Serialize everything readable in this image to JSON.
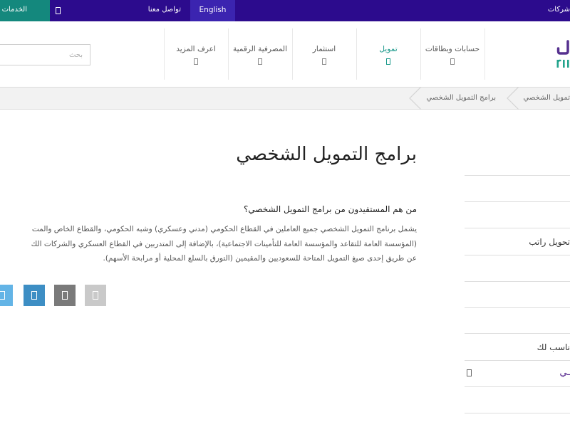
{
  "topbar": {
    "services_label": "الخدمات",
    "services_icon": "grid-icon",
    "contact_label": "تواصل معنا",
    "language_label": "English",
    "companies_label": "شركات",
    "colors": {
      "bar": "#2c0b8d",
      "services": "#14887d",
      "language": "#3b24b0"
    }
  },
  "logo": {
    "colors": {
      "primary": "#56318f",
      "secondary": "#22a38c"
    }
  },
  "nav": {
    "search_placeholder": "بحث",
    "item_icon": "chevron-down-icon",
    "items": [
      {
        "label": "حسابات وبطاقات",
        "active": false
      },
      {
        "label": "تمويل",
        "active": true
      },
      {
        "label": "استثمار",
        "active": false
      },
      {
        "label": "المصرفية الرقمية",
        "active": false
      },
      {
        "label": "اعرف المزيد",
        "active": false
      }
    ]
  },
  "breadcrumb": {
    "items": [
      "تمويل الشخصي",
      "برامج التمويل الشخصي"
    ]
  },
  "main": {
    "title": "برامج التمويل الشخصي",
    "question": "من هم المستفيدون من برامج التمويل الشخصي؟",
    "paragraph_lines": [
      "يشمل برنامج التمويل الشخصي جميع العاملين في القطاع الحكومي (مدني وعسكري) وشبه الحكومي، والقطاع الخاص والمت",
      "(المؤسسة العامة للتقاعد والمؤسسة العامة للتأمينات الاجتماعية)، بالإضافة إلى المتدربين في القطاع العسكري والشركات الك",
      "عن طريق إحدى صيغ التمويل المتاحة للسعوديين والمقيمين (التورق بالسلع المحلية أو مرابحة الأسهم)."
    ]
  },
  "share": [
    {
      "icon": "print-icon",
      "color": "#c9c9c9"
    },
    {
      "icon": "email-icon",
      "color": "#7a7a7a"
    },
    {
      "icon": "linkedin-icon",
      "color": "#3d8ec4"
    },
    {
      "icon": "twitter-icon",
      "color": "#63b4e6"
    }
  ],
  "sidebar": {
    "salary_transfer_label": "تحويل راتب",
    "section_title": "ناسب لك",
    "active_item_label": "ـي",
    "active_item_icon": "chevron-icon",
    "active_color": "#5a2d91"
  }
}
